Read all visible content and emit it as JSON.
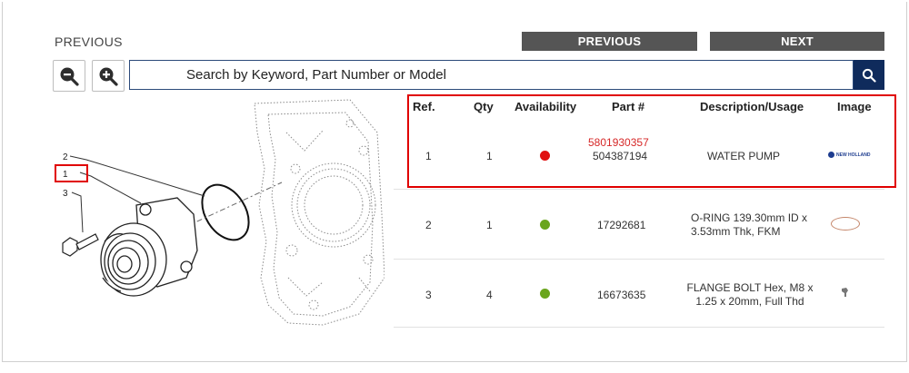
{
  "nav": {
    "previous_label": "PREVIOUS",
    "previous_button": "PREVIOUS",
    "next_button": "NEXT"
  },
  "search": {
    "placeholder": "Search by Keyword, Part Number or Model"
  },
  "diagram": {
    "callouts": [
      "2",
      "1",
      "3"
    ]
  },
  "table": {
    "headers": {
      "ref": "Ref.",
      "qty": "Qty",
      "availability": "Availability",
      "part": "Part #",
      "description": "Description/Usage",
      "image": "Image"
    },
    "rows": [
      {
        "ref": "1",
        "qty": "1",
        "availability_color": "#e01010",
        "part_new": "5801930357",
        "part": "504387194",
        "description": "WATER PUMP",
        "image_logo": "NEW HOLLAND"
      },
      {
        "ref": "2",
        "qty": "1",
        "availability_color": "#6aa51d",
        "part": "17292681",
        "description_line1": "O-RING 139.30mm ID x",
        "description_line2": "3.53mm Thk, FKM"
      },
      {
        "ref": "3",
        "qty": "4",
        "availability_color": "#6aa51d",
        "part": "16673635",
        "description_line1": "FLANGE BOLT Hex, M8 x",
        "description_line2": "1.25 x 20mm, Full Thd"
      }
    ]
  },
  "colors": {
    "nav_button": "#555555",
    "search_button": "#0f2b5c",
    "highlight": "#e00000",
    "part_new": "#d62828"
  }
}
